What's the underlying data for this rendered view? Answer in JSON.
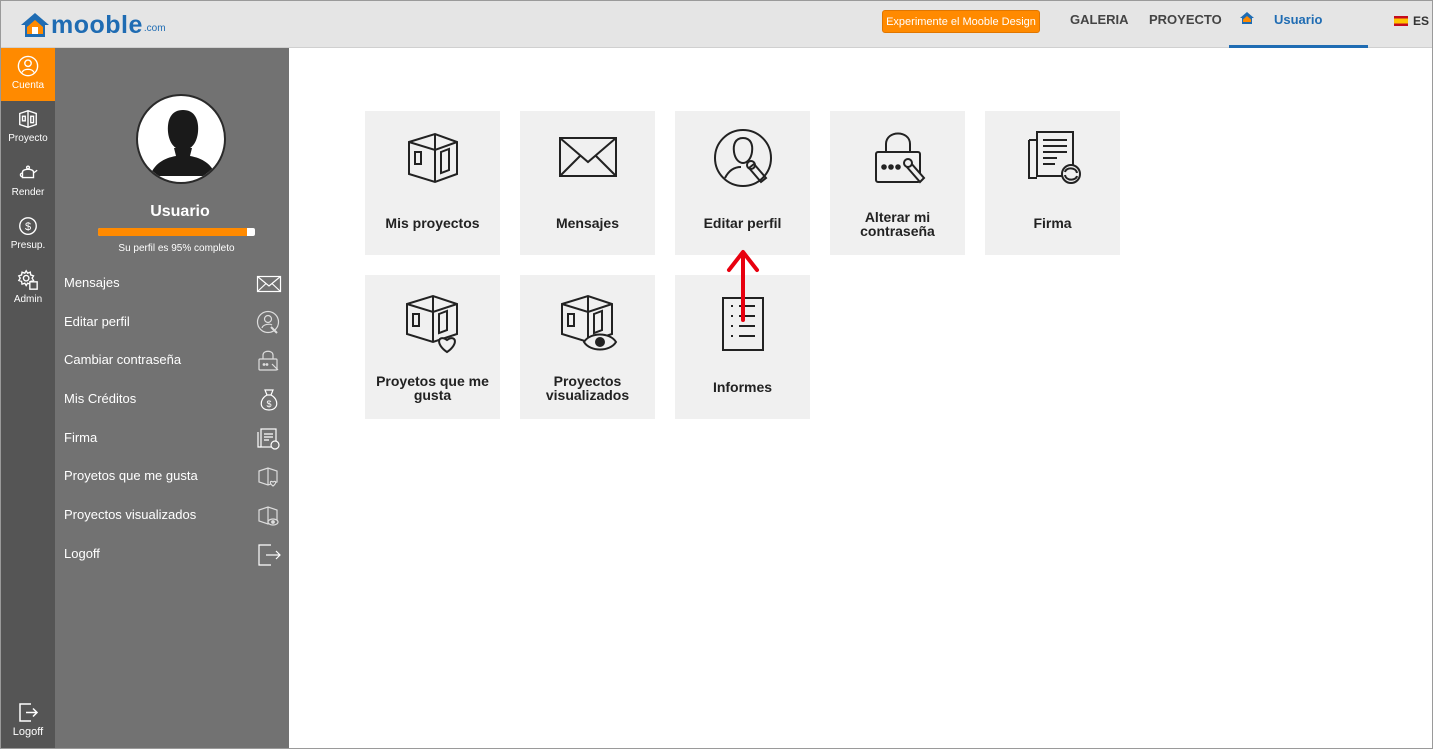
{
  "header": {
    "logo_text": "mooble",
    "logo_suffix": ".com",
    "cta_label": "Experimente el Mooble Design",
    "nav": {
      "galeria": "GALERIA",
      "proyecto": "PROYECTO",
      "usuario": "Usuario"
    },
    "language": "ES"
  },
  "rail": {
    "items": [
      {
        "label": "Cuenta",
        "icon": "user-circle-icon"
      },
      {
        "label": "Proyecto",
        "icon": "room-icon"
      },
      {
        "label": "Render",
        "icon": "teapot-icon"
      },
      {
        "label": "Presup.",
        "icon": "dollar-icon"
      },
      {
        "label": "Admin",
        "icon": "gear-icon"
      }
    ],
    "logoff_label": "Logoff"
  },
  "panel": {
    "username": "Usuario",
    "profile_completion": 0.95,
    "progress_text": "Su perfil es 95% completo",
    "menu": [
      {
        "label": "Mensajes",
        "icon": "envelope-icon"
      },
      {
        "label": "Editar perfil",
        "icon": "user-edit-icon"
      },
      {
        "label": "Cambiar contraseña",
        "icon": "lock-icon"
      },
      {
        "label": "Mis Créditos",
        "icon": "money-bag-icon"
      },
      {
        "label": "Firma",
        "icon": "document-refresh-icon"
      },
      {
        "label": "Proyetos que me gusta",
        "icon": "room-heart-icon"
      },
      {
        "label": "Proyectos visualizados",
        "icon": "room-eye-icon"
      },
      {
        "label": "Logoff",
        "icon": "logout-icon"
      }
    ]
  },
  "tiles": [
    {
      "label_lines": [
        "Mis proyectos"
      ],
      "icon": "room-icon"
    },
    {
      "label_lines": [
        "Mensajes"
      ],
      "icon": "envelope-icon"
    },
    {
      "label_lines": [
        "Editar perfil"
      ],
      "icon": "user-edit-icon"
    },
    {
      "label_lines": [
        "Alterar mi",
        "contraseña"
      ],
      "icon": "lock-icon"
    },
    {
      "label_lines": [
        "Firma"
      ],
      "icon": "document-refresh-icon"
    },
    {
      "label_lines": [
        "Proyetos que me",
        "gusta"
      ],
      "icon": "room-heart-icon"
    },
    {
      "label_lines": [
        "Proyectos",
        "visualizados"
      ],
      "icon": "room-eye-icon"
    },
    {
      "label_lines": [
        "Informes"
      ],
      "icon": "report-list-icon"
    }
  ],
  "colors": {
    "accent_orange": "#ff8a00",
    "brand_blue": "#1f6cb3",
    "annotation_red": "#e8000f"
  }
}
